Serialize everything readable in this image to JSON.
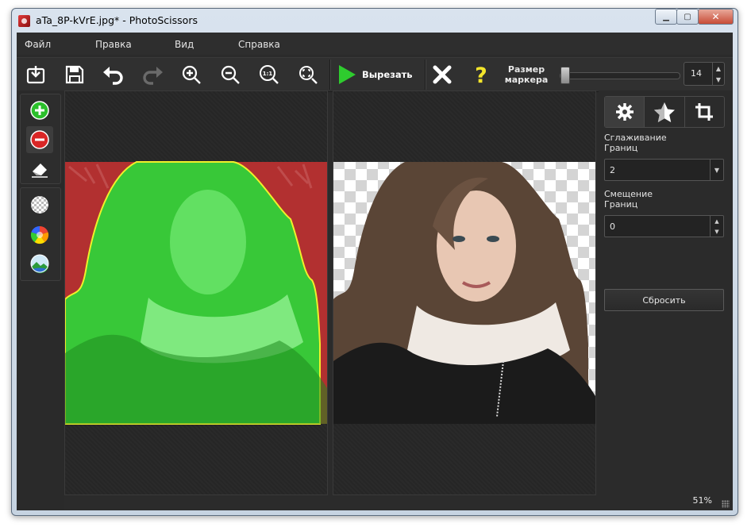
{
  "window": {
    "title": "aTa_8P-kVrE.jpg* - PhotoScissors"
  },
  "menu": [
    "Файл",
    "Правка",
    "Вид",
    "Справка"
  ],
  "toolbar": {
    "cut_label": "Вырезать",
    "marker_label_1": "Размер",
    "marker_label_2": "маркера",
    "marker_size": "14",
    "marker_level": 0.05
  },
  "panel": {
    "smoothing_label_1": "Сглаживание",
    "smoothing_label_2": "Границ",
    "smoothing_value": "2",
    "offset_label_1": "Смещение",
    "offset_label_2": "Границ",
    "offset_value": "0",
    "reset_label": "Сбросить"
  },
  "status": {
    "zoom": "51%"
  },
  "colors": {
    "keep_marker": "#22c322",
    "remove_marker": "#d71f24",
    "outline": "#f0f02a"
  },
  "icons": [
    "open-icon",
    "save-icon",
    "undo-icon",
    "redo-icon",
    "zoom-in-icon",
    "zoom-out-icon",
    "actual-size-icon",
    "fit-icon",
    "play-icon",
    "close-icon",
    "help-icon",
    "plus-icon",
    "minus-icon",
    "eraser-icon",
    "checker-icon",
    "color-wheel-icon",
    "landscape-icon",
    "gear-icon",
    "star-icon",
    "crop-icon"
  ]
}
